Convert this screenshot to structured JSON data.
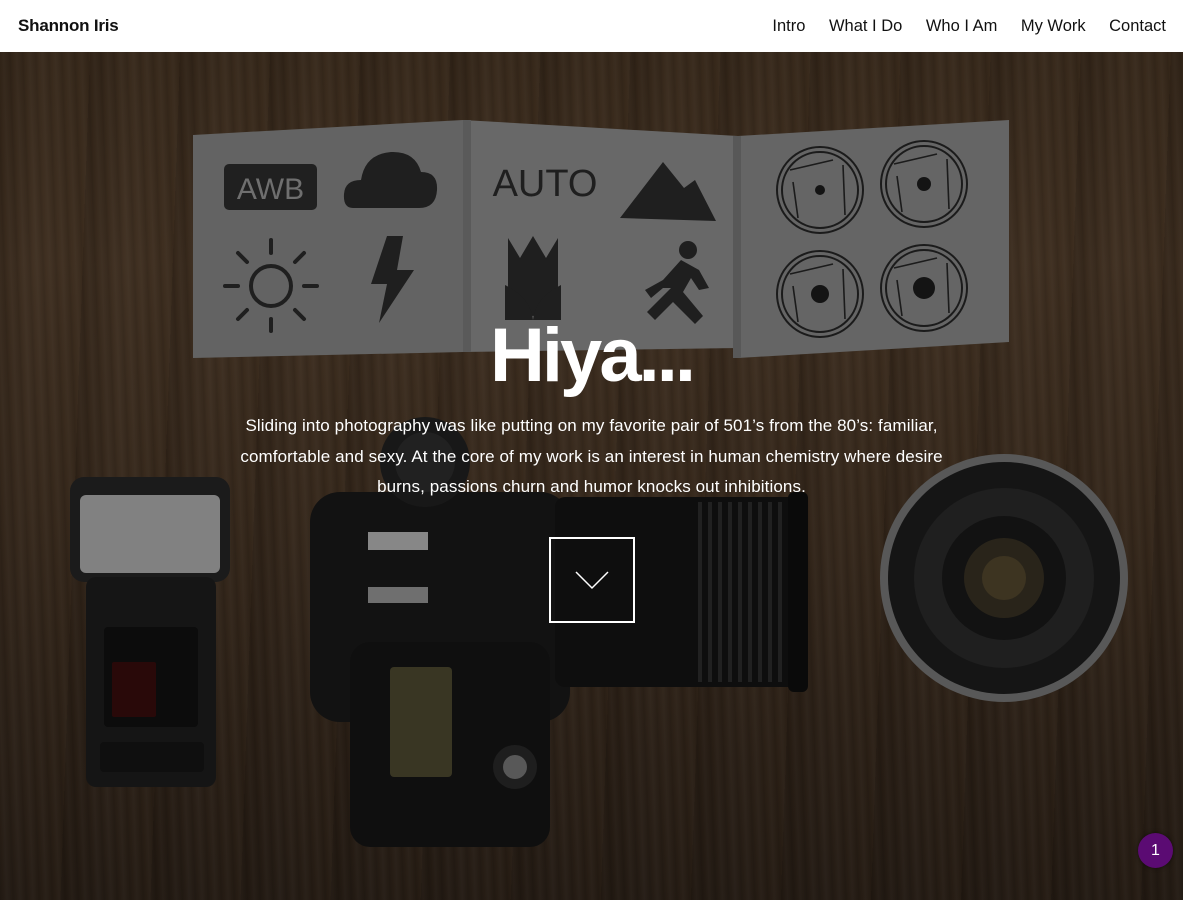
{
  "header": {
    "brand": "Shannon Iris",
    "nav": [
      {
        "label": "Intro"
      },
      {
        "label": "What I Do"
      },
      {
        "label": "Who I Am"
      },
      {
        "label": "My Work"
      },
      {
        "label": "Contact"
      }
    ]
  },
  "hero": {
    "title": "Hiya...",
    "text": "Sliding into photography was like putting on my favorite pair of 501’s from the 80’s: familiar, comfortable and sexy. At the core of my work is an interest in human chemistry where desire burns, passions churn and humor knocks out inhibitions.",
    "scroll_icon": "chevron-down-icon",
    "image_labels": {
      "awb": "AWB",
      "auto": "AUTO"
    }
  },
  "badge": {
    "count": "1"
  },
  "colors": {
    "header_bg": "#ffffff",
    "text_light": "#ffffff",
    "badge_bg": "#5b0b73"
  }
}
